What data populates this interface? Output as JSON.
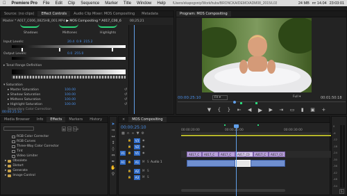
{
  "menubar": {
    "apple": "",
    "app": "Premiere Pro",
    "items": [
      "File",
      "Edit",
      "Clip",
      "Sequence",
      "Marker",
      "Title",
      "Window",
      "Help"
    ],
    "path": "/Users/ekapogoniy/Work/hubs/BRONCKA/DEMO/ADM08_2015/L03 Three-way Color Corrector start.prproj *",
    "battery": "24 MB",
    "date": "пт 14.04",
    "time": "23:03:01"
  },
  "effect_controls": {
    "tabs": [
      "Source: (no clips)",
      "Effect Controls",
      "Audio Clip Mixer: MOS Compositing",
      "Metadata"
    ],
    "active_tab": 1,
    "header_master": "Master * A017_C006_0825HB_001.MP4",
    "header_seq": "MOS Compositing * A017_C00_6",
    "timecode": "00;25;21",
    "wheels": {
      "shadows": "Shadows",
      "midtones": "Midtones",
      "highlights": "Highlights"
    },
    "input_levels": {
      "label": "Input Levels:",
      "v1": "20.4",
      "v2": "0.9",
      "v3": "215.2"
    },
    "output_levels": {
      "label": "Output Levels:",
      "v1": "0.0",
      "v2": "255.0"
    },
    "tonal": "Tonal Range Definition",
    "saturation": {
      "label": "Saturation",
      "rows": [
        {
          "label": "Master Saturation",
          "value": "100.00"
        },
        {
          "label": "Shadow Saturation",
          "value": "100.00"
        },
        {
          "label": "Midtone Saturation",
          "value": "100.00"
        },
        {
          "label": "Highlight Saturation",
          "value": "100.00"
        }
      ],
      "more": "Secondary Color Correction"
    },
    "footer_timecode": "00:00:25:10"
  },
  "program": {
    "title": "Program: MOS Compositing",
    "timecode": "00:00:25:10",
    "fit": "Fit",
    "quality": "Full",
    "duration": "00:01:50:18"
  },
  "project": {
    "tabs": [
      "Media Browser",
      "Info",
      "Effects",
      "Markers",
      "History"
    ],
    "active_tab": 2,
    "items": [
      {
        "label": "RGB Color Corrector",
        "indent": 1,
        "icon": "fx-icon"
      },
      {
        "label": "RGB Curves",
        "indent": 1,
        "icon": "fx-icon"
      },
      {
        "label": "Three-Way Color Corrector",
        "indent": 1,
        "icon": "fx-icon"
      },
      {
        "label": "Tint",
        "indent": 1,
        "icon": "fx-icon"
      },
      {
        "label": "Video Limiter",
        "indent": 1,
        "icon": "fx-icon"
      },
      {
        "label": "Obsolete",
        "indent": 0,
        "icon": "folder-icon"
      },
      {
        "label": "Distort",
        "indent": 0,
        "icon": "folder-icon"
      },
      {
        "label": "Generate",
        "indent": 0,
        "icon": "folder-icon"
      },
      {
        "label": "Image Control",
        "indent": 0,
        "icon": "folder-icon"
      }
    ]
  },
  "timeline": {
    "tab": "MOS Compositing",
    "timecode": "00:00:25:10",
    "ruler": [
      "00:00:20:00",
      "00:00:25:00",
      "00:00:30:00"
    ],
    "tracks": [
      {
        "src": "",
        "name": "V3",
        "label": ""
      },
      {
        "src": "",
        "name": "V2",
        "label": ""
      },
      {
        "src": "V1",
        "name": "V1",
        "label": ""
      },
      {
        "src": "A1",
        "name": "A1",
        "label": "Audio 1"
      },
      {
        "src": "",
        "name": "A2",
        "label": ""
      },
      {
        "src": "",
        "name": "A3",
        "label": ""
      }
    ],
    "video_clips": [
      "A017_C",
      "A017_C",
      "A017_C",
      "A017_C0",
      "A017_C",
      "A017_C0"
    ]
  },
  "meter": {
    "labels": [
      "0",
      "-6",
      "-12",
      "-18",
      "-24",
      "-30",
      "-36",
      "-42",
      "-48",
      "-54"
    ],
    "solo": "S"
  },
  "colors": {
    "accent": "#4a8fe7",
    "video_clip": "#b7a0d8",
    "audio_clip": "#6f8fd0",
    "playhead": "#62a0ea"
  }
}
